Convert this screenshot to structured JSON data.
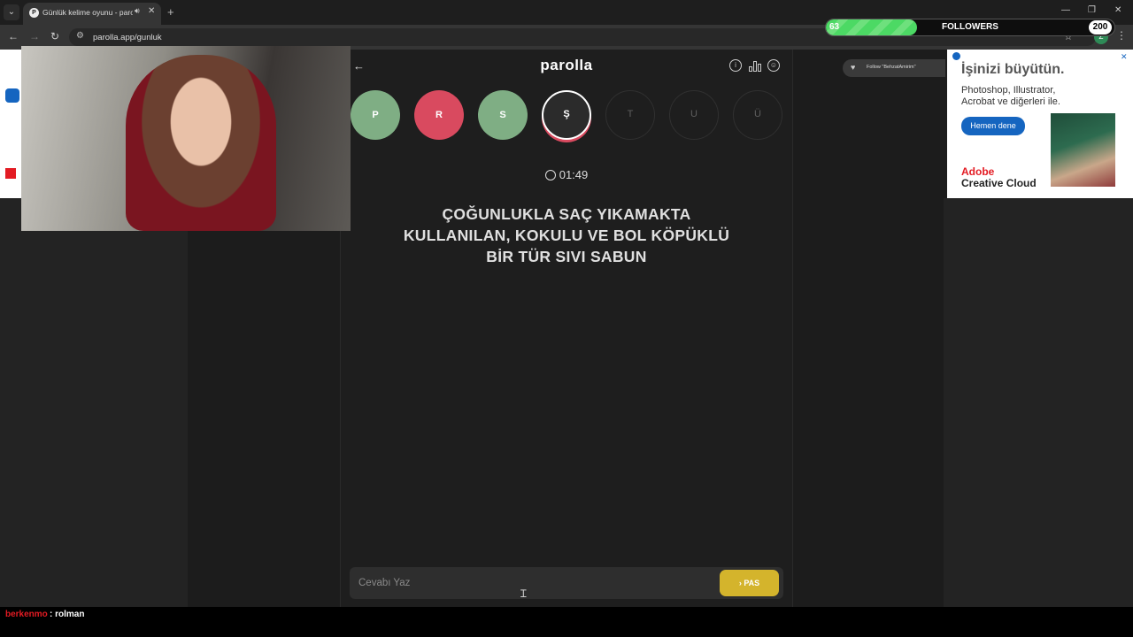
{
  "browser": {
    "tab_title": "Günlük kelime oyunu - parolla",
    "tab_favicon": "P",
    "url": "parolla.app/gunluk",
    "profile_initial": "Z"
  },
  "overlay": {
    "followers_label": "FOLLOWERS",
    "followers_current": "63",
    "followers_goal": "200",
    "followers_progress": 0.315,
    "follow_alert_text": "Follow \"BehzatAmirim\"",
    "chat_user": "berkenmo",
    "chat_message": ": rolman"
  },
  "game": {
    "logo": "parolla",
    "letters": [
      {
        "char": "P",
        "state": "correct"
      },
      {
        "char": "R",
        "state": "wrong"
      },
      {
        "char": "S",
        "state": "correct"
      },
      {
        "char": "Ş",
        "state": "active"
      },
      {
        "char": "T",
        "state": "pending"
      },
      {
        "char": "U",
        "state": "pending"
      },
      {
        "char": "Ü",
        "state": "pending"
      }
    ],
    "timer": "01:49",
    "question": "ÇOĞUNLUKLA SAÇ YIKAMAKTA KULLANILAN, KOKULU VE BOL KÖPÜKLÜ BİR TÜR SIVI SABUN",
    "answer_placeholder": "Cevabı Yaz",
    "pass_label": "PAS"
  },
  "ad": {
    "headline": "İşinizi büyütün.",
    "body": "Photoshop, Illustrator, Acrobat ve diğerleri ile.",
    "cta": "Hemen dene",
    "brand_line1": "Adobe",
    "brand_line2": "Creative Cloud"
  },
  "colors": {
    "correct": "#7fae84",
    "wrong": "#d94a5f",
    "pass_button": "#d4b42c",
    "followers_bar": "#4cd964"
  }
}
